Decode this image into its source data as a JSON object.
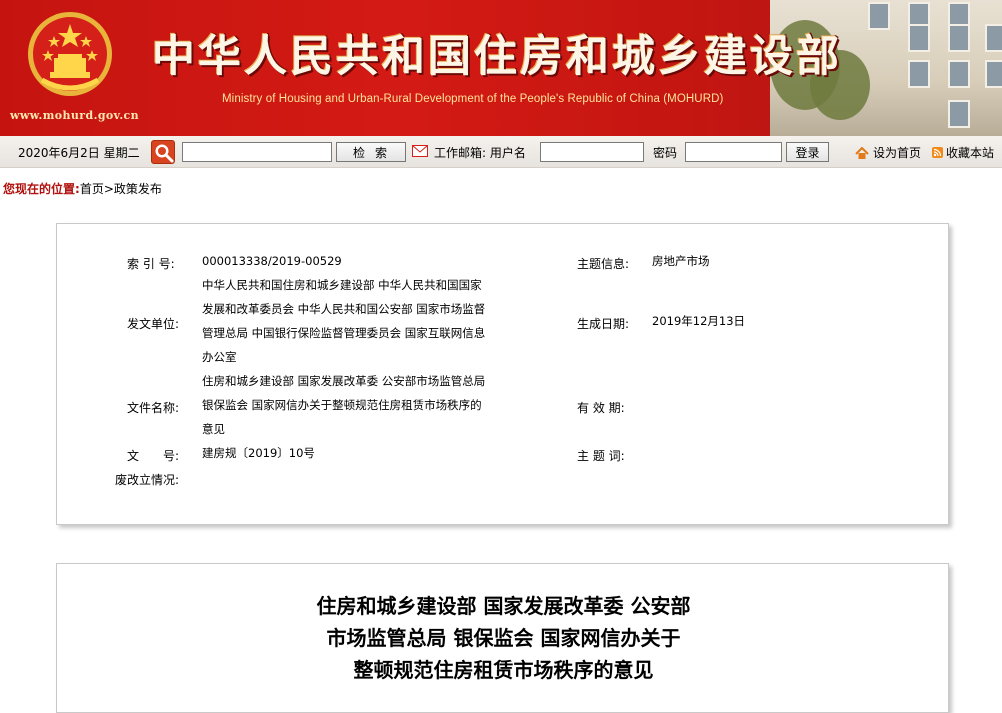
{
  "header": {
    "title_cn": "中华人民共和国住房和城乡建设部",
    "title_en": "Ministry of Housing and Urban-Rural Development of the People's Republic of China (MOHURD)",
    "site_url": "www.mohurd.gov.cn",
    "brand_color": "#c51410"
  },
  "toolbar": {
    "date": "2020年6月2日 星期二",
    "search_button": "检索",
    "mail_label": "工作邮箱: 用户名",
    "password_label": "密码",
    "login_button": "登录",
    "set_homepage": "设为首页",
    "bookmark": "收藏本站"
  },
  "breadcrumb": {
    "label": "您现在的位置:",
    "items": [
      "首页",
      "政策发布"
    ],
    "separator": ">"
  },
  "info": {
    "index_label": "索 引 号:",
    "index_value": "000013338/2019-00529",
    "issuer_label": "发文单位:",
    "issuer_lines": [
      "中华人民共和国住房和城乡建设部 中华人民共和国国家",
      "发展和改革委员会 中华人民共和国公安部 国家市场监督",
      "管理总局 中国银行保险监督管理委员会 国家互联网信息",
      "办公室"
    ],
    "filename_label": "文件名称:",
    "filename_lines": [
      "住房和城乡建设部 国家发展改革委 公安部市场监管总局",
      "银保监会 国家网信办关于整顿规范住房租赁市场秩序的",
      "意见"
    ],
    "docno_label": "文　　号:",
    "docno_value": "建房规〔2019〕10号",
    "status_label": "废改立情况:",
    "status_value": "",
    "topic_label": "主题信息:",
    "topic_value": "房地产市场",
    "date_label": "生成日期:",
    "date_value": "2019年12月13日",
    "validity_label": "有 效 期:",
    "validity_value": "",
    "keywords_label": "主 题 词:",
    "keywords_value": ""
  },
  "document": {
    "title_lines": [
      "住房和城乡建设部 国家发展改革委 公安部",
      "市场监管总局 银保监会 国家网信办关于",
      "整顿规范住房租赁市场秩序的意见"
    ]
  }
}
